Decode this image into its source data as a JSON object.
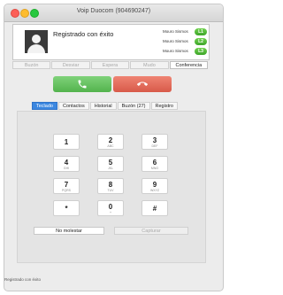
{
  "window": {
    "title": "Voip Duocom (904690247)"
  },
  "status": {
    "registration_text": "Registrado con éxito",
    "lines": [
      {
        "label": "Mouro Sismos",
        "badge": "L1"
      },
      {
        "label": "Mouro Sismos",
        "badge": "L2"
      },
      {
        "label": "Mouro Sismos",
        "badge": "L3"
      }
    ]
  },
  "actions": [
    {
      "label": "Buzón",
      "enabled": false
    },
    {
      "label": "Desviar",
      "enabled": false
    },
    {
      "label": "Espera",
      "enabled": false
    },
    {
      "label": "Mudo",
      "enabled": false
    },
    {
      "label": "Conferencia",
      "enabled": true
    }
  ],
  "tabs": [
    {
      "label": "Teclado",
      "active": true
    },
    {
      "label": "Contactos",
      "active": false
    },
    {
      "label": "Historial",
      "active": false
    },
    {
      "label": "Buzón (27)",
      "active": false
    },
    {
      "label": "Registro",
      "active": false
    }
  ],
  "keypad": [
    {
      "digit": "1",
      "letters": ""
    },
    {
      "digit": "2",
      "letters": "ABC"
    },
    {
      "digit": "3",
      "letters": "DEF"
    },
    {
      "digit": "4",
      "letters": "GHI"
    },
    {
      "digit": "5",
      "letters": "JKL"
    },
    {
      "digit": "6",
      "letters": "MNO"
    },
    {
      "digit": "7",
      "letters": "PQRS"
    },
    {
      "digit": "8",
      "letters": "TUV"
    },
    {
      "digit": "9",
      "letters": "WXYZ"
    },
    {
      "digit": "*",
      "letters": ""
    },
    {
      "digit": "0",
      "letters": "+"
    },
    {
      "digit": "#",
      "letters": ""
    }
  ],
  "bottom": {
    "dnd_label": "No molestar",
    "capture_label": "Capturar"
  },
  "statusbar": {
    "text": "Registrado con éxito"
  },
  "colors": {
    "answer": "#5cbd55",
    "hangup": "#e06452",
    "active_tab": "#3b87e0",
    "line_badge": "#4cb634"
  },
  "icons": {
    "answer": "phone-icon",
    "hangup": "hang-up-icon"
  }
}
